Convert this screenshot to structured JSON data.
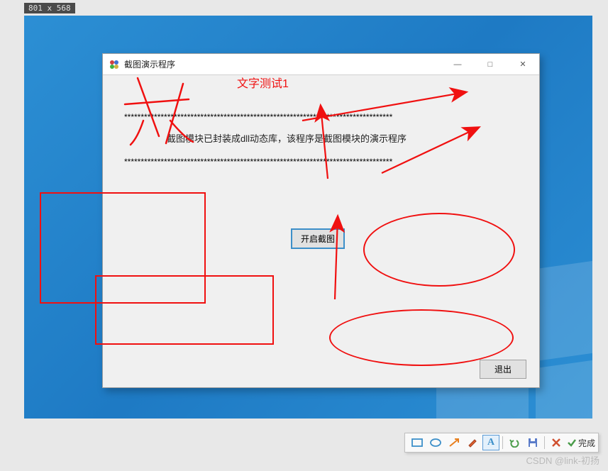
{
  "selection_size": "801 x 568",
  "window": {
    "title": "截图演示程序",
    "minimize": "—",
    "maximize": "□",
    "close": "✕"
  },
  "annotation": {
    "text1": "文字测试1"
  },
  "content": {
    "divider": "*********************************************************************************",
    "description": "截图模块已封装成dll动态库，该程序是截图模块的演示程序",
    "open_button": "开启截图",
    "exit_button": "退出"
  },
  "toolbar": {
    "rect": "rectangle",
    "ellipse": "ellipse",
    "arrow": "arrow",
    "brush": "brush",
    "text": "A",
    "undo": "undo",
    "save": "save",
    "cancel": "cancel",
    "done": "完成"
  },
  "watermark": "CSDN @link-初扬"
}
